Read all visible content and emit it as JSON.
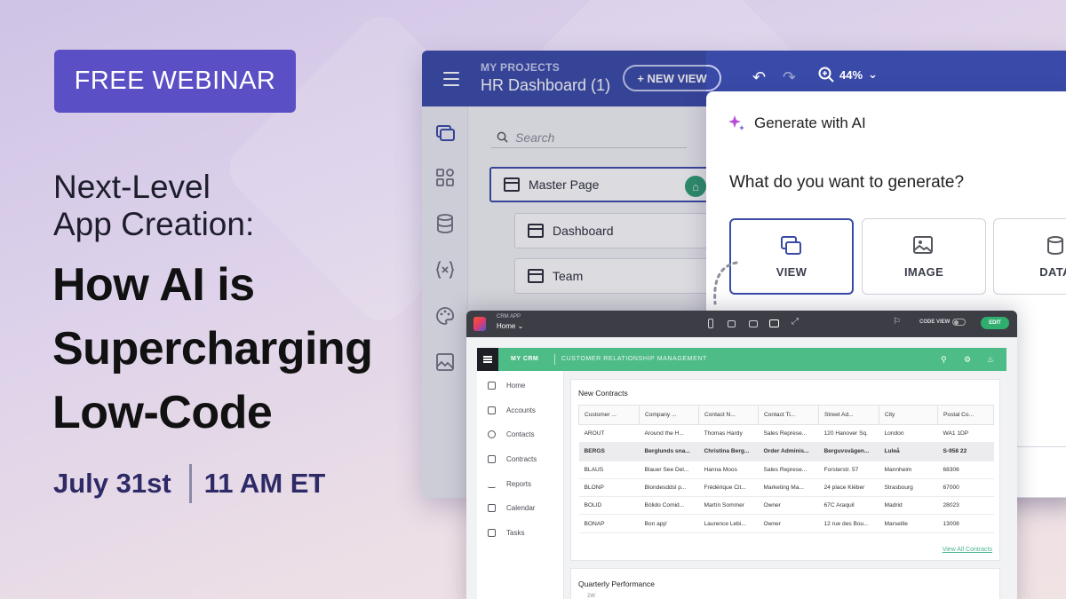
{
  "promo": {
    "badge": "FREE WEBINAR",
    "subtitle_line1": "Next-Level",
    "subtitle_line2": "App Creation:",
    "headline_line1": "How AI is",
    "headline_line2": "Supercharging",
    "headline_line3": "Low-Code",
    "date": "July 31st",
    "time": "11 AM ET"
  },
  "builder": {
    "project_label": "MY PROJECTS",
    "project_name": "HR Dashboard (1)",
    "new_view": "+ NEW VIEW",
    "zoom": "44%",
    "search_placeholder": "Search",
    "pages": [
      "Master Page",
      "Dashboard",
      "Team"
    ]
  },
  "ai_panel": {
    "title": "Generate with AI",
    "question": "What do you want to generate?",
    "options": [
      "VIEW",
      "IMAGE",
      "DATA"
    ]
  },
  "crm": {
    "app_label": "CRM APP",
    "page": "Home",
    "code_view": "CODE VIEW",
    "edit": "EDIT",
    "brand": "MY CRM",
    "subtitle": "CUSTOMER RELATIONSHIP MANAGEMENT",
    "nav": [
      "Home",
      "Accounts",
      "Contacts",
      "Contracts",
      "Reports",
      "Calendar",
      "Tasks"
    ],
    "contracts_title": "New Contracts",
    "columns": [
      "Customer ...",
      "Company ...",
      "Contact N...",
      "Contact Ti...",
      "Street Ad...",
      "City",
      "Postal Co..."
    ],
    "rows": [
      [
        "AROUT",
        "Around the H...",
        "Thomas Hardy",
        "Sales Represe...",
        "120 Hanover Sq.",
        "London",
        "WA1 1DP"
      ],
      [
        "BERGS",
        "Berglunds sna...",
        "Christina Berg...",
        "Order Adminis...",
        "Berguvsvägen...",
        "Luleå",
        "S-958 22"
      ],
      [
        "BLAUS",
        "Blauer See Del...",
        "Hanna Moos",
        "Sales Represe...",
        "Forsterstr. 57",
        "Mannheim",
        "68306"
      ],
      [
        "BLONP",
        "Blondesddsl p...",
        "Frédérique Cit...",
        "Marketing Ma...",
        "24 place Kléber",
        "Strasbourg",
        "67000"
      ],
      [
        "BOLID",
        "Bólido Comid...",
        "Martín Sommer",
        "Owner",
        "67C Araquil",
        "Madrid",
        "28023"
      ],
      [
        "BONAP",
        "Bon app'",
        "Laurence Lebi...",
        "Owner",
        "12 rue des Bou...",
        "Marseille",
        "13008"
      ]
    ],
    "view_all": "View All Contracts",
    "performance_title": "Quarterly Performance",
    "performance_sub": "2W"
  },
  "colors": {
    "badge_bg": "#5a4fc4",
    "builder_header": "#3a4aa8",
    "crm_accent": "#4ebc87",
    "date_text": "#2e2a66"
  }
}
